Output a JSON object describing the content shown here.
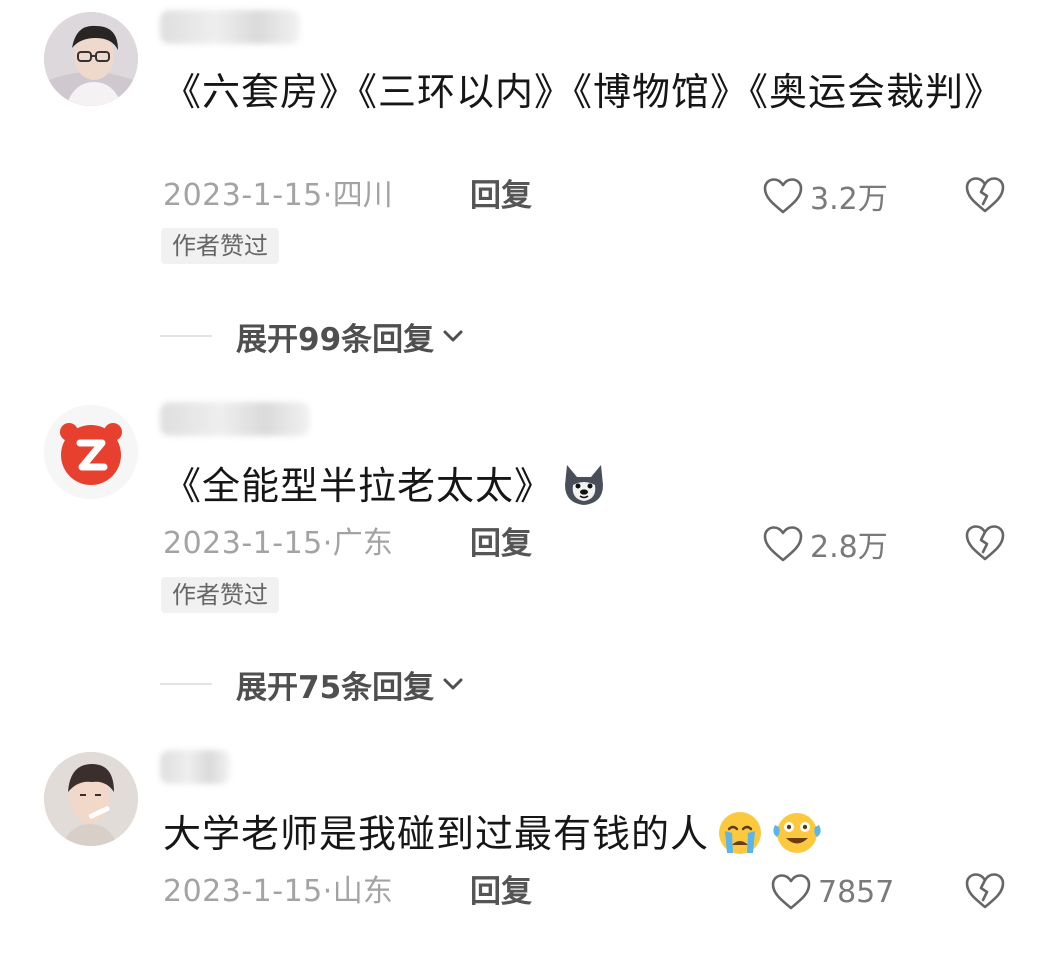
{
  "comments": [
    {
      "avatar_icon": "user-avatar-glasses-man",
      "text": "《六套房》《三环以内》《博物馆》《奥运会裁判》",
      "date": "2023-1-15·",
      "location": "四川",
      "reply_label": "回复",
      "like_icon": "heart-outline-icon",
      "likes": "3.2万",
      "dislike_icon": "broken-heart-icon",
      "author_liked": "作者赞过",
      "expand_label": "展开99条回复"
    },
    {
      "avatar_icon": "zhihu-style-red-logo-avatar",
      "text": "《全能型半拉老太太》",
      "emoji": "husky-dog-emoji",
      "date": "2023-1-15·",
      "location": "广东",
      "reply_label": "回复",
      "like_icon": "heart-outline-icon",
      "likes": "2.8万",
      "dislike_icon": "broken-heart-icon",
      "author_liked": "作者赞过",
      "expand_label": "展开75条回复"
    },
    {
      "avatar_icon": "user-avatar-young-man",
      "text": "大学老师是我碰到过最有钱的人",
      "emojis": [
        "crying-face-emoji",
        "tears-of-joy-emoji"
      ],
      "date": "2023-1-15·",
      "location": "山东",
      "reply_label": "回复",
      "like_icon": "heart-outline-icon",
      "likes": "7857",
      "dislike_icon": "broken-heart-icon"
    }
  ],
  "colors": {
    "text_primary": "#161616",
    "text_meta": "#a3a3a3",
    "reply": "#555555",
    "tag_bg": "#f1f1f1",
    "avatar_red": "#e8402f"
  }
}
